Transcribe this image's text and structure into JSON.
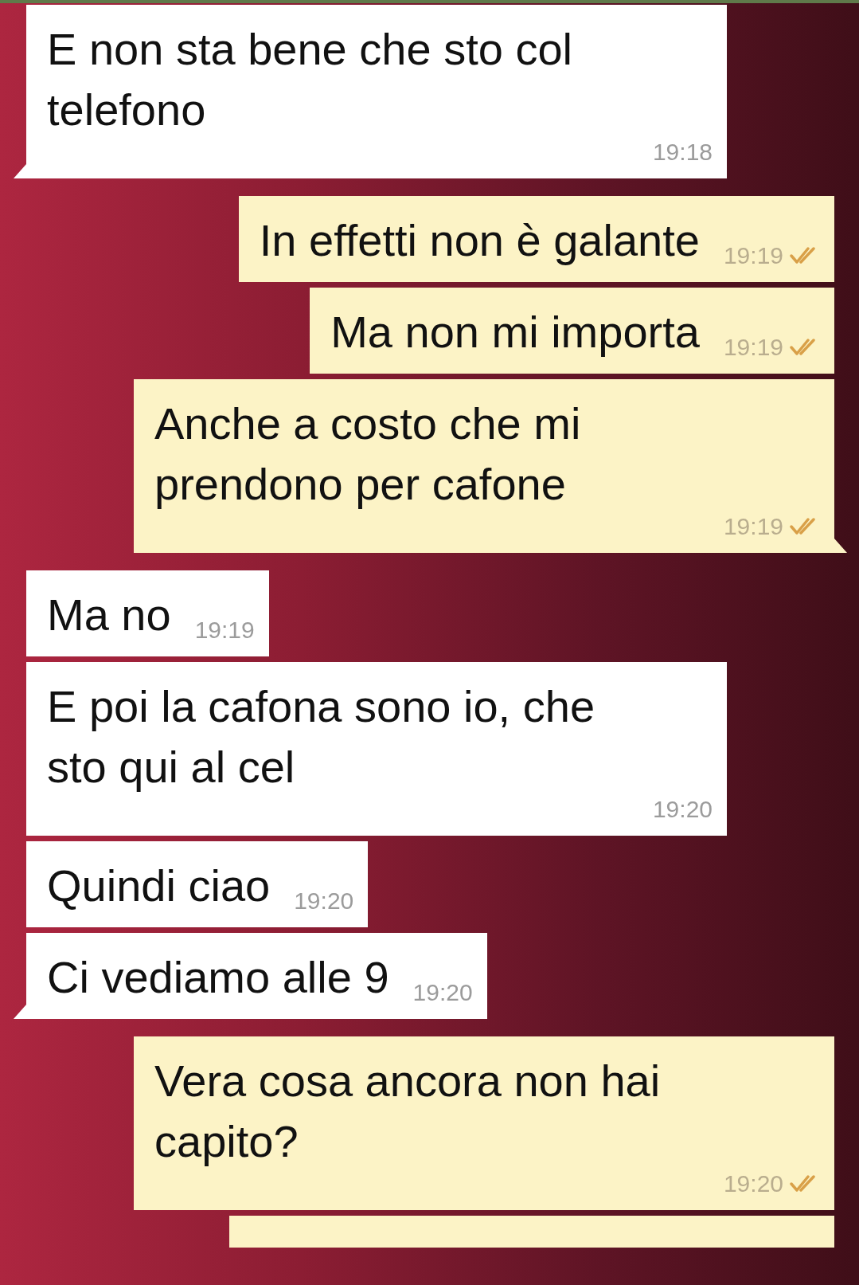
{
  "messages": [
    {
      "kind": "incoming",
      "text": "E non sta bene che sto col telefono",
      "time": "19:18",
      "tail": true
    },
    {
      "kind": "outgoing",
      "text": "In effetti non è galante",
      "time": "19:19",
      "read": true,
      "tail": false
    },
    {
      "kind": "outgoing",
      "text": "Ma non mi importa",
      "time": "19:19",
      "read": true,
      "tail": false
    },
    {
      "kind": "outgoing",
      "text": "Anche a costo che mi prendono per cafone",
      "time": "19:19",
      "read": true,
      "tail": true
    },
    {
      "kind": "incoming",
      "text": "Ma no",
      "time": "19:19",
      "tail": false
    },
    {
      "kind": "incoming",
      "text": "E poi la cafona sono io, che sto qui al cel",
      "time": "19:20",
      "tail": false
    },
    {
      "kind": "incoming",
      "text": "Quindi ciao",
      "time": "19:20",
      "tail": false
    },
    {
      "kind": "incoming",
      "text": "Ci vediamo alle 9",
      "time": "19:20",
      "tail": true
    },
    {
      "kind": "outgoing",
      "text": "Vera cosa ancora non hai capito?",
      "time": "19:20",
      "read": true,
      "tail": false
    }
  ]
}
